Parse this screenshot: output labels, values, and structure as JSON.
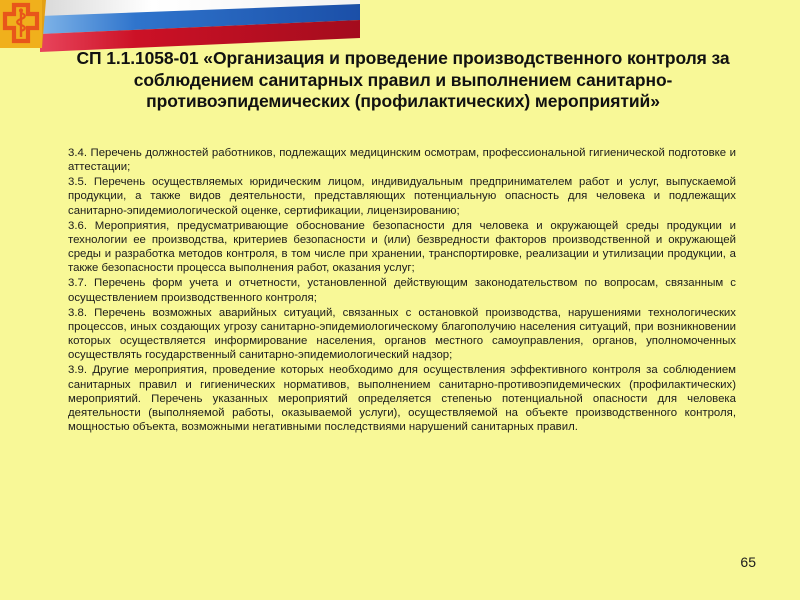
{
  "slide": {
    "background_color": "#f8f897",
    "title": "СП 1.1.1058-01 «Организация и проведение производственного контроля за соблюдением санитарных правил и выполнением санитарно-противоэпидемических (профилактических) мероприятий»",
    "slide_number": "65",
    "paragraphs": [
      {
        "id": "3.4",
        "text": "3.4. Перечень должностей работников, подлежащих медицинским осмотрам, профессиональной гигиенической подготовке и аттестации;"
      },
      {
        "id": "3.5",
        "text": "3.5. Перечень осуществляемых юридическим лицом, индивидуальным предпринимателем работ и услуг, выпускаемой продукции, а также видов деятельности, представляющих потенциальную опасность для человека и подлежащих санитарно-эпидемиологической оценке, сертификации, лицензированию;"
      },
      {
        "id": "3.6",
        "text": "3.6. Мероприятия, предусматривающие обоснование безопасности для человека и окружающей среды продукции и технологии ее производства, критериев безопасности и (или) безвредности факторов производственной и окружающей среды и разработка методов контроля, в том числе при хранении, транспортировке, реализации и утилизации продукции, а также безопасности процесса выполнения работ, оказания услуг;"
      },
      {
        "id": "3.7",
        "text": "3.7. Перечень форм учета и отчетности, установленной действующим законодательством по вопросам, связанным с осуществлением производственного контроля;"
      },
      {
        "id": "3.8",
        "text": "3.8. Перечень возможных аварийных ситуаций, связанных с остановкой производства, нарушениями технологических процессов, иных создающих угрозу санитарно-эпидемиологическому благополучию населения ситуаций, при возникновении которых осуществляется информирование населения, органов местного самоуправления, органов, уполномоченных осуществлять государственный санитарно-эпидемиологический надзор;"
      },
      {
        "id": "3.9",
        "text": "3.9. Другие мероприятия, проведение которых необходимо для осуществления эффективного контроля за соблюдением санитарных правил и гигиенических нормативов, выполнением санитарно-противоэпидемических (профилактических) мероприятий. Перечень указанных мероприятий определяется степенью потенциальной опасности для человека деятельности (выполняемой работы, оказываемой услуги), осуществляемой на объекте производственного контроля, мощностью объекта, возможными негативными последствиями нарушений санитарных правил."
      }
    ],
    "decoration": {
      "logo_name": "medical-cross-caduceus-logo",
      "logo_cross_color": "#e8561a",
      "logo_plaque_color": "#f2b21c",
      "flag_colors": {
        "white": "#ffffff",
        "blue": "#1f5fc4",
        "red": "#cc1126"
      }
    }
  }
}
